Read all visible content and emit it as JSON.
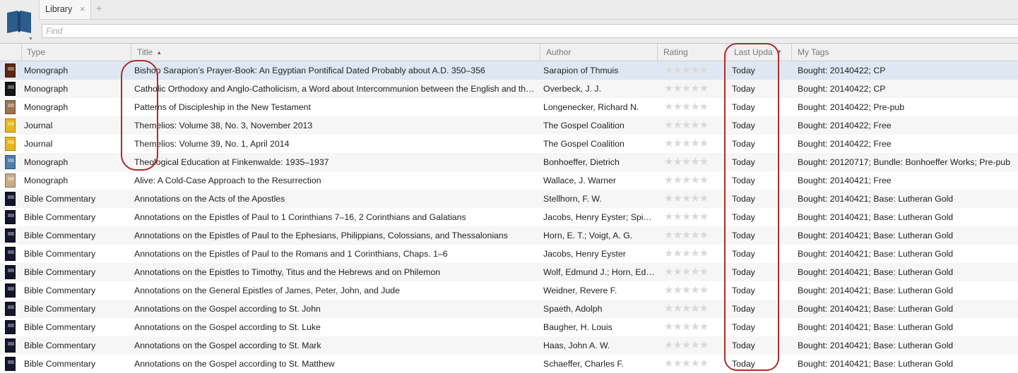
{
  "toolbar": {
    "logo_icon": "open-book-icon",
    "tab_label": "Library",
    "tab_close": "×",
    "tab_add": "+",
    "search_placeholder": "Find"
  },
  "columns": {
    "type": "Type",
    "title": "Title",
    "author": "Author",
    "rating": "Rating",
    "date": "Last Upda",
    "tags": "My Tags"
  },
  "sort": {
    "column": "Title",
    "direction": "ascending",
    "asc_glyph": "▲",
    "desc_glyph": "▼"
  },
  "rows": [
    {
      "type": "Monograph",
      "title": "Bishop Sarapion’s Prayer-Book: An Egyptian Pontifical Dated Probably about A.D. 350–356",
      "author": "Sarapion of Thmuis",
      "rating": "★★★★★",
      "date": "Today",
      "tags": "Bought: 20140422; CP",
      "cover": "rust"
    },
    {
      "type": "Monograph",
      "title": "Catholic Orthodoxy and Anglo-Catholicism, a Word about Intercommunion between the English and th…",
      "author": "Overbeck, J. J.",
      "rating": "★★★★★",
      "date": "Today",
      "tags": "Bought: 20140422; CP",
      "cover": "black"
    },
    {
      "type": "Monograph",
      "title": "Patterns of Discipleship in the New Testament",
      "author": "Longenecker, Richard N.",
      "rating": "★★★★★",
      "date": "Today",
      "tags": "Bought: 20140422; Pre-pub",
      "cover": "tan"
    },
    {
      "type": "Journal",
      "title": "Themelios: Volume 38, No. 3, November 2013",
      "author": "The Gospel Coalition",
      "rating": "★★★★★",
      "date": "Today",
      "tags": "Bought: 20140422; Free",
      "cover": "yellow"
    },
    {
      "type": "Journal",
      "title": "Themelios: Volume 39, No. 1, April 2014",
      "author": "The Gospel Coalition",
      "rating": "★★★★★",
      "date": "Today",
      "tags": "Bought: 20140422; Free",
      "cover": "yellow"
    },
    {
      "type": "Monograph",
      "title": "Theological Education at Finkenwalde: 1935–1937",
      "author": "Bonhoeffer, Dietrich",
      "rating": "★★★★★",
      "date": "Today",
      "tags": "Bought: 20120717; Bundle: Bonhoeffer Works; Pre-pub",
      "cover": "blue"
    },
    {
      "type": "Monograph",
      "title": "Alive: A Cold-Case Approach to the Resurrection",
      "author": "Wallace, J. Warner",
      "rating": "★★★★★",
      "date": "Today",
      "tags": "Bought: 20140421; Free",
      "cover": "sand"
    },
    {
      "type": "Bible Commentary",
      "title": "Annotations on the Acts of the Apostles",
      "author": "Stellhorn, F. W.",
      "rating": "★★★★★",
      "date": "Today",
      "tags": "Bought: 20140421; Base: Lutheran Gold",
      "cover": "navy"
    },
    {
      "type": "Bible Commentary",
      "title": "Annotations on the Epistles of Paul to 1 Corinthians 7–16, 2 Corinthians and Galatians",
      "author": "Jacobs, Henry Eyster; Spie…",
      "rating": "★★★★★",
      "date": "Today",
      "tags": "Bought: 20140421; Base: Lutheran Gold",
      "cover": "navy"
    },
    {
      "type": "Bible Commentary",
      "title": "Annotations on the Epistles of Paul to the Ephesians, Philippians, Colossians, and Thessalonians",
      "author": "Horn, E. T.; Voigt, A. G.",
      "rating": "★★★★★",
      "date": "Today",
      "tags": "Bought: 20140421; Base: Lutheran Gold",
      "cover": "navy"
    },
    {
      "type": "Bible Commentary",
      "title": "Annotations on the Epistles of Paul to the Romans and 1 Corinthians, Chaps. 1–6",
      "author": "Jacobs, Henry Eyster",
      "rating": "★★★★★",
      "date": "Today",
      "tags": "Bought: 20140421; Base: Lutheran Gold",
      "cover": "navy"
    },
    {
      "type": "Bible Commentary",
      "title": "Annotations on the Epistles to Timothy, Titus and the Hebrews and on Philemon",
      "author": "Wolf, Edmund J.; Horn, Ed…",
      "rating": "★★★★★",
      "date": "Today",
      "tags": "Bought: 20140421; Base: Lutheran Gold",
      "cover": "navy"
    },
    {
      "type": "Bible Commentary",
      "title": "Annotations on the General Epistles of James, Peter, John, and Jude",
      "author": "Weidner, Revere F.",
      "rating": "★★★★★",
      "date": "Today",
      "tags": "Bought: 20140421; Base: Lutheran Gold",
      "cover": "navy"
    },
    {
      "type": "Bible Commentary",
      "title": "Annotations on the Gospel according to St. John",
      "author": "Spaeth, Adolph",
      "rating": "★★★★★",
      "date": "Today",
      "tags": "Bought: 20140421; Base: Lutheran Gold",
      "cover": "navy"
    },
    {
      "type": "Bible Commentary",
      "title": "Annotations on the Gospel according to St. Luke",
      "author": "Baugher, H. Louis",
      "rating": "★★★★★",
      "date": "Today",
      "tags": "Bought: 20140421; Base: Lutheran Gold",
      "cover": "navy"
    },
    {
      "type": "Bible Commentary",
      "title": "Annotations on the Gospel according to St. Mark",
      "author": "Haas, John A. W.",
      "rating": "★★★★★",
      "date": "Today",
      "tags": "Bought: 20140421; Base: Lutheran Gold",
      "cover": "navy"
    },
    {
      "type": "Bible Commentary",
      "title": "Annotations on the Gospel according to St. Matthew",
      "author": "Schaeffer, Charles F.",
      "rating": "★★★★★",
      "date": "Today",
      "tags": "Bought: 20140421; Base: Lutheran Gold",
      "cover": "navy"
    }
  ],
  "colors": {
    "selected_row": "#dfe8f2",
    "annotation": "#b02a2a",
    "logo": "#2b5d8c"
  }
}
